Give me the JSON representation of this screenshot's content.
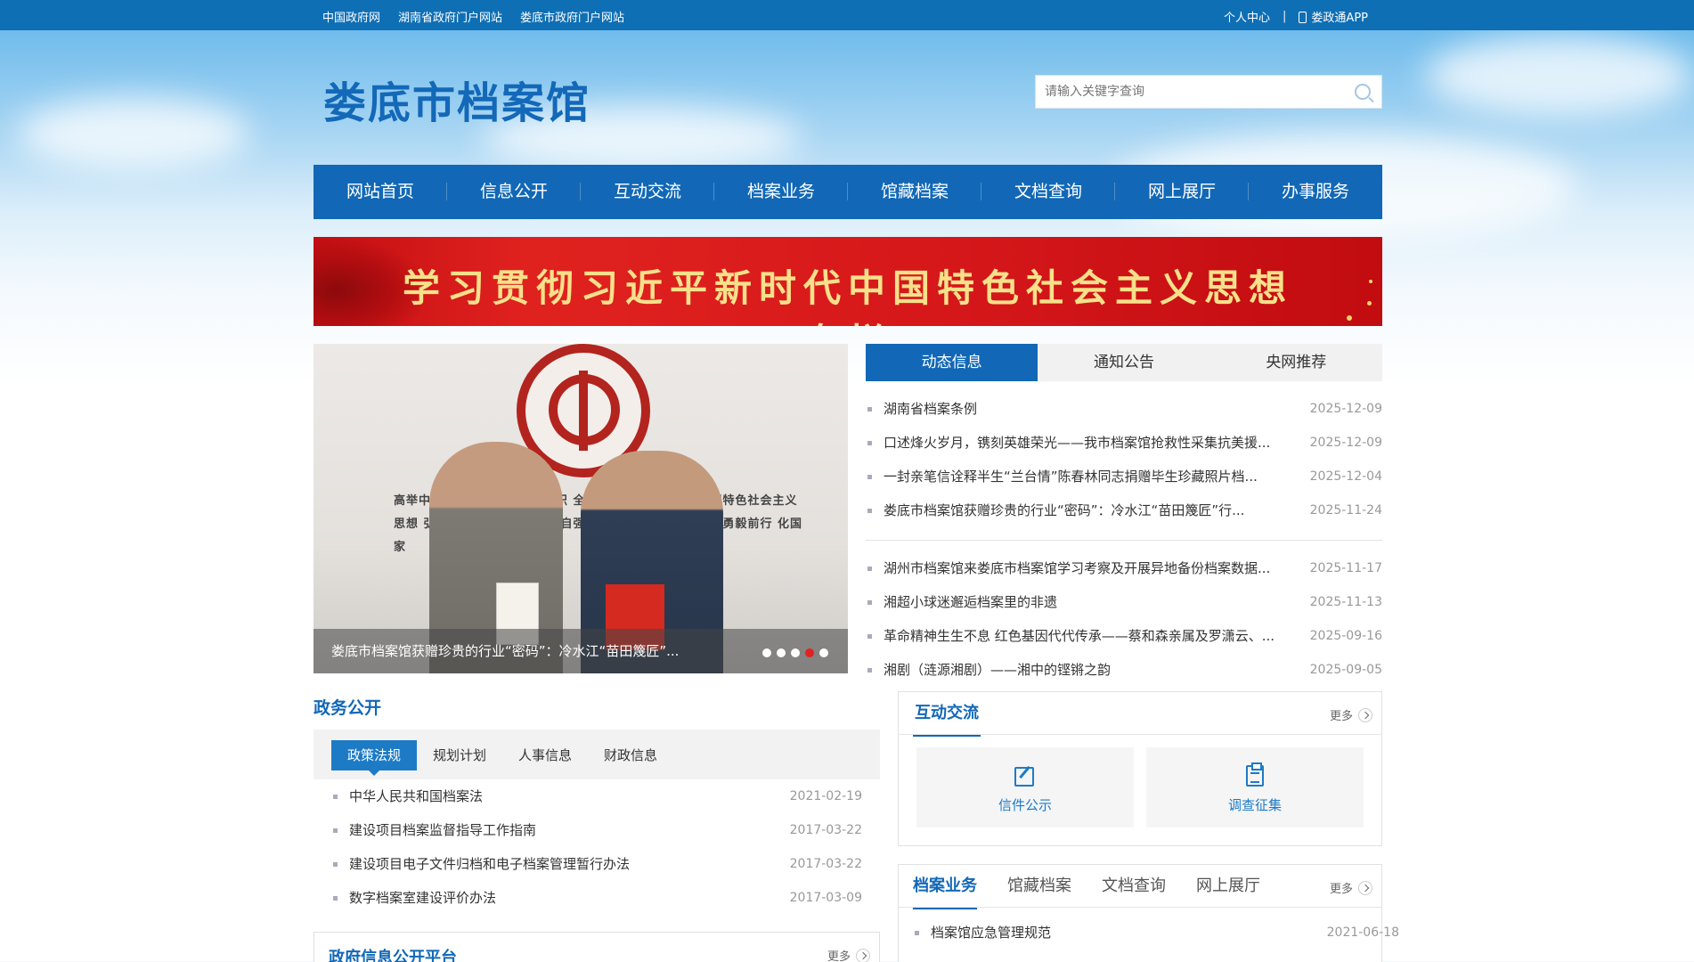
{
  "topbar": {
    "links": [
      "中国政府网",
      "湖南省政府门户网站",
      "娄底市政府门户网站"
    ],
    "personal": "个人中心",
    "separator": "|",
    "app": "娄政通APP"
  },
  "site": {
    "title": "娄底市档案馆",
    "search_placeholder": "请输入关键字查询"
  },
  "nav": [
    "网站首页",
    "信息公开",
    "互动交流",
    "档案业务",
    "馆藏档案",
    "文档查询",
    "网上展厅",
    "办事服务"
  ],
  "banner": {
    "text": "学习贯彻习近平新时代中国特色社会主义思想专栏"
  },
  "carousel": {
    "caption": "娄底市档案馆获赠珍贵的行业“密码”：冷水江“苗田篾匠”...",
    "wall_text": "高举中国特色社会主义伟大旗帜 全面贯彻习近平新时代中国特色社会主义思想 弘扬伟大建党精神，自信自强、守正创新、踔厉奋发、勇毅前行 化国家",
    "active_dot": 4,
    "dot_count": 5
  },
  "news": {
    "tabs": [
      "动态信息",
      "通知公告",
      "央网推荐"
    ],
    "items_top": [
      {
        "title": "湖南省档案条例",
        "date": "2025-12-09"
      },
      {
        "title": "口述烽火岁月，镌刻英雄荣光——我市档案馆抢救性采集抗美援...",
        "date": "2025-12-09"
      },
      {
        "title": "一封亲笔信诠释半生“兰台情”陈春林同志捐赠毕生珍藏照片档...",
        "date": "2025-12-04"
      },
      {
        "title": "娄底市档案馆获赠珍贵的行业“密码”：冷水江“苗田篾匠”行...",
        "date": "2025-11-24"
      }
    ],
    "items_bottom": [
      {
        "title": "湖州市档案馆来娄底市档案馆学习考察及开展异地备份档案数据...",
        "date": "2025-11-17"
      },
      {
        "title": "湘超小球迷邂逅档案里的非遗",
        "date": "2025-11-13"
      },
      {
        "title": "革命精神生生不息 红色基因代代传承——蔡和森亲属及罗潇云、...",
        "date": "2025-09-16"
      },
      {
        "title": "湘剧（涟源湘剧）——湘中的铿锵之韵",
        "date": "2025-09-05"
      }
    ]
  },
  "zhengwu": {
    "title": "政务公开",
    "tabs": [
      "政策法规",
      "规划计划",
      "人事信息",
      "财政信息"
    ],
    "items": [
      {
        "title": "中华人民共和国档案法",
        "date": "2021-02-19"
      },
      {
        "title": "建设项目档案监督指导工作指南",
        "date": "2017-03-22"
      },
      {
        "title": "建设项目电子文件归档和电子档案管理暂行办法",
        "date": "2017-03-22"
      },
      {
        "title": "数字档案室建设评价办法",
        "date": "2017-03-09"
      }
    ],
    "platform_title": "政府信息公开平台",
    "more": "更多"
  },
  "hudong": {
    "title": "互动交流",
    "more": "更多",
    "cards": [
      "信件公示",
      "调查征集"
    ]
  },
  "dangan": {
    "tabs": [
      "档案业务",
      "馆藏档案",
      "文档查询",
      "网上展厅"
    ],
    "more": "更多",
    "items": [
      {
        "title": "档案馆应急管理规范",
        "date": "2021-06-18"
      }
    ]
  },
  "colors": {
    "primary": "#1268b6",
    "topbar": "#0f6fb5",
    "banner_red": "#d5171a",
    "banner_text": "#f7e08a"
  }
}
